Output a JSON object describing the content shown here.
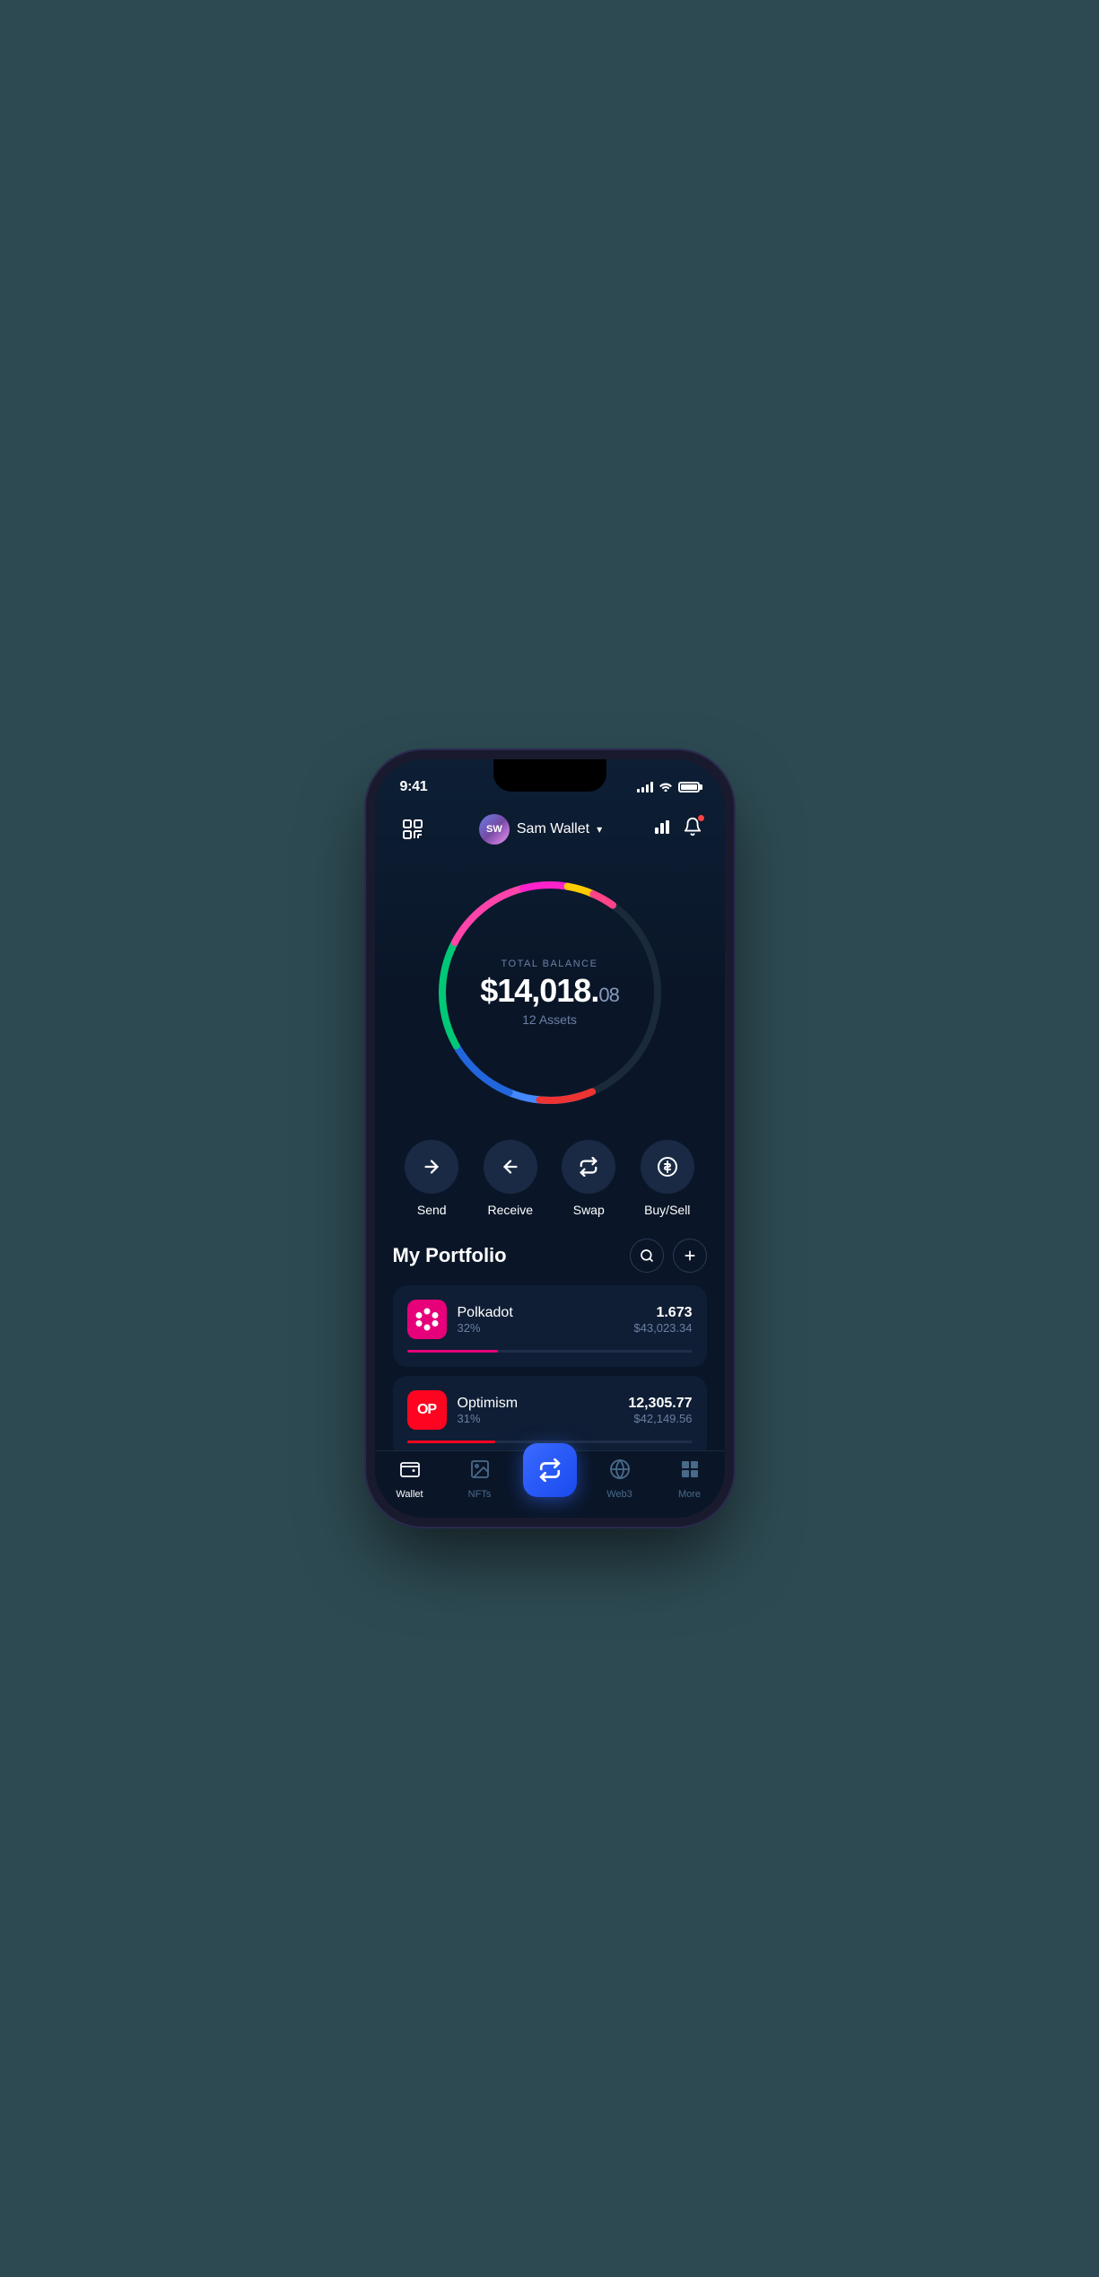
{
  "status": {
    "time": "9:41"
  },
  "header": {
    "scan_icon": "⊡",
    "avatar_initials": "SW",
    "wallet_name": "Sam Wallet",
    "chart_icon": "chart-icon",
    "bell_icon": "bell-icon"
  },
  "balance": {
    "label": "TOTAL BALANCE",
    "amount_main": "$14,018.",
    "amount_cents": "08",
    "assets_count": "12 Assets"
  },
  "actions": [
    {
      "id": "send",
      "label": "Send",
      "icon": "→"
    },
    {
      "id": "receive",
      "label": "Receive",
      "icon": "←"
    },
    {
      "id": "swap",
      "label": "Swap",
      "icon": "⇅"
    },
    {
      "id": "buysell",
      "label": "Buy/Sell",
      "icon": "💲"
    }
  ],
  "portfolio": {
    "title": "My Portfolio",
    "search_icon": "search",
    "add_icon": "plus",
    "assets": [
      {
        "id": "polkadot",
        "name": "Polkadot",
        "percent": "32%",
        "amount": "1.673",
        "usd": "$43,023.34",
        "progress": 32,
        "color": "#e6007a"
      },
      {
        "id": "optimism",
        "name": "Optimism",
        "percent": "31%",
        "amount": "12,305.77",
        "usd": "$42,149.56",
        "progress": 31,
        "color": "#ff0420"
      }
    ]
  },
  "nav": {
    "items": [
      {
        "id": "wallet",
        "label": "Wallet",
        "active": true
      },
      {
        "id": "nfts",
        "label": "NFTs",
        "active": false
      },
      {
        "id": "swap-center",
        "label": "",
        "active": false,
        "is_center": true
      },
      {
        "id": "web3",
        "label": "Web3",
        "active": false
      },
      {
        "id": "more",
        "label": "More",
        "active": false
      }
    ]
  },
  "colors": {
    "bg": "#0a1628",
    "card": "#0f1e35",
    "accent_blue": "#3a6aff",
    "text_primary": "#ffffff",
    "text_secondary": "#6b7fa3"
  }
}
